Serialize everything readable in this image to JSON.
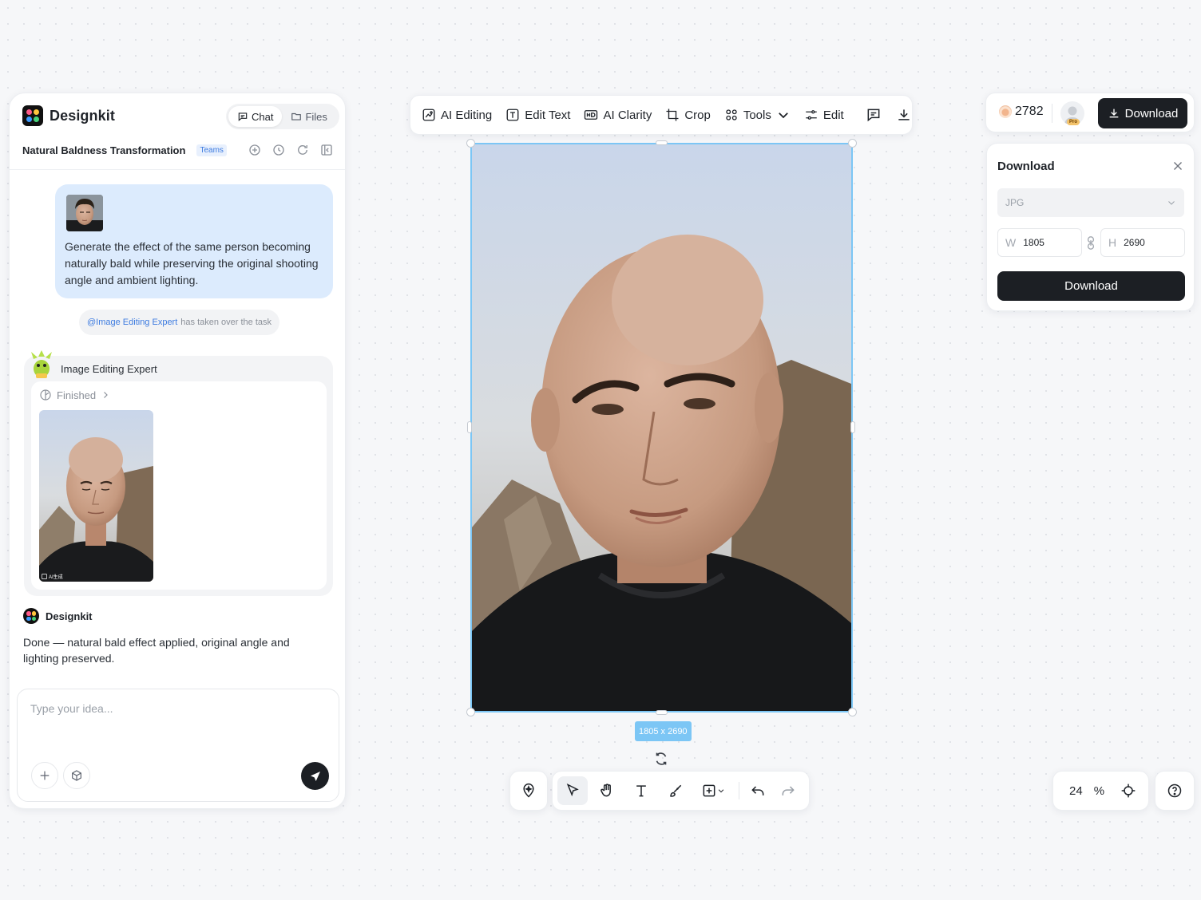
{
  "brand": {
    "name": "Designkit"
  },
  "sidebar_tabs": {
    "chat": "Chat",
    "files": "Files"
  },
  "conversation": {
    "title": "Natural Baldness Transformation",
    "badge": "Teams"
  },
  "user_message": {
    "text": "Generate the effect of the same person becoming naturally bald while preserving the original shooting angle and ambient lighting."
  },
  "takeover": {
    "mention": "@Image Editing Expert",
    "text": "has taken over the task"
  },
  "expert": {
    "name": "Image Editing Expert",
    "status": "Finished",
    "ai_tag": "AI生成"
  },
  "assistant": {
    "name": "Designkit",
    "reply": "Done — natural bald effect applied, original angle and lighting preserved."
  },
  "composer": {
    "placeholder": "Type your idea..."
  },
  "toolbar": {
    "ai_editing": "AI Editing",
    "edit_text": "Edit Text",
    "ai_clarity": "AI Clarity",
    "crop": "Crop",
    "tools": "Tools",
    "edit": "Edit"
  },
  "canvas": {
    "dimension_label": "1805 x 2690"
  },
  "zoom": {
    "value": "24",
    "unit": "%"
  },
  "account": {
    "credits": "2782",
    "pro_badge": "Pro",
    "download_label": "Download"
  },
  "download_panel": {
    "title": "Download",
    "format": "JPG",
    "width_label": "W",
    "width": "1805",
    "height_label": "H",
    "height": "2690",
    "button": "Download"
  },
  "colors": {
    "accent": "#3d7be0",
    "selection": "#7cc6f5",
    "bubble": "#dcebfd",
    "primary_button": "#1c1f24"
  }
}
